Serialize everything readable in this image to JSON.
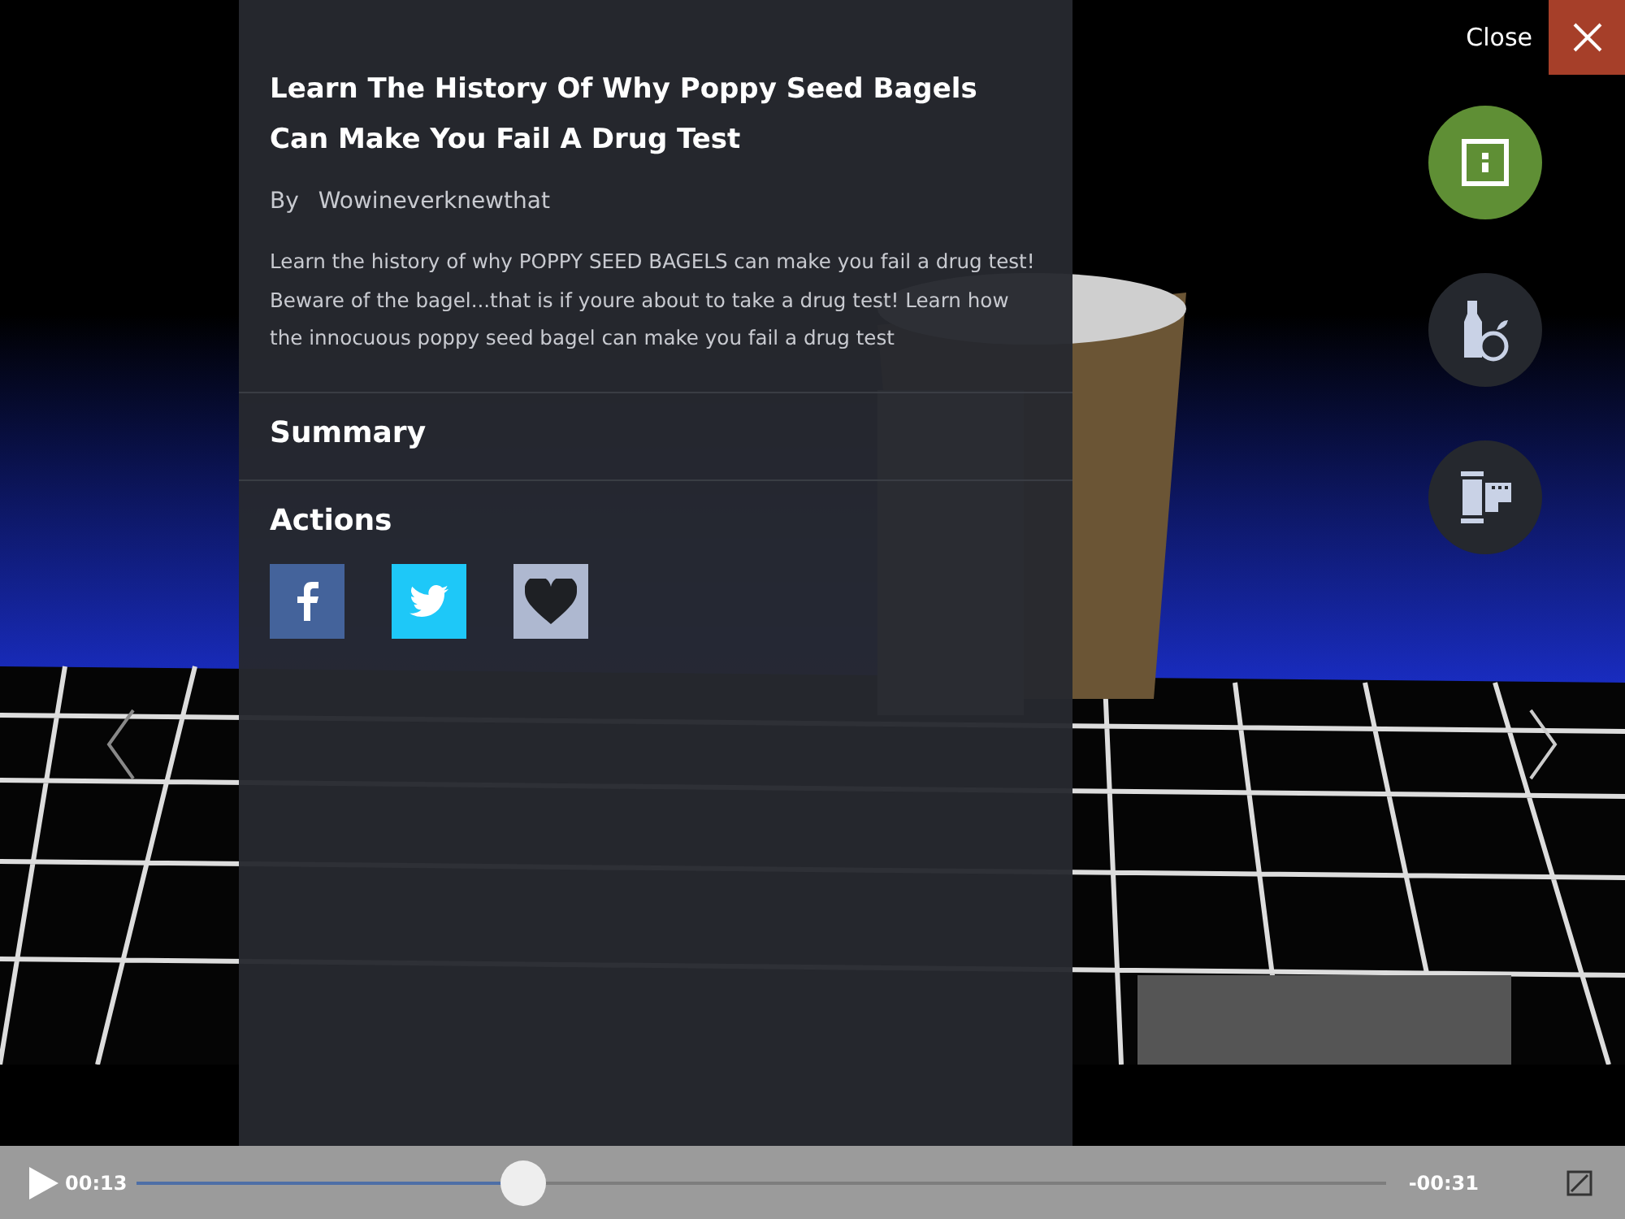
{
  "close": {
    "label": "Close"
  },
  "side_buttons": [
    {
      "kind": "info",
      "selected": true
    },
    {
      "kind": "bottle",
      "selected": false
    },
    {
      "kind": "film",
      "selected": false
    }
  ],
  "panel": {
    "title": "Learn The History Of Why Poppy Seed Bagels Can Make You Fail A Drug Test",
    "by_label": "By",
    "author": "Wowineverknewthat",
    "description": "Learn the history of why POPPY SEED BAGELS can make you fail a drug test! Beware of the bagel...that is if youre about to take a drug test! Learn how the innocuous poppy seed bagel can make you fail a drug test",
    "sections": [
      "Summary",
      "Actions"
    ],
    "actions": [
      {
        "kind": "facebook",
        "color": "#44639b"
      },
      {
        "kind": "twitter",
        "color": "#1ec8f8"
      },
      {
        "kind": "favorite",
        "color": "#aeb8d0"
      }
    ]
  },
  "player": {
    "elapsed": "00:13",
    "remaining": "-00:31",
    "level": 0.31
  }
}
